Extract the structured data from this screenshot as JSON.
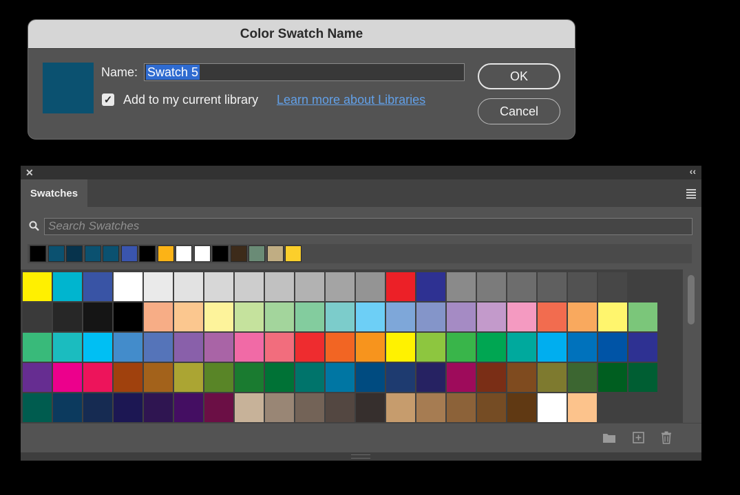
{
  "dialog": {
    "title": "Color Swatch Name",
    "preview_color": "#0b5170",
    "name_label": "Name:",
    "name_value": "Swatch 5",
    "checkbox_checked": true,
    "checkbox_label": "Add to my current library",
    "link_text": "Learn more about Libraries",
    "ok_label": "OK",
    "cancel_label": "Cancel"
  },
  "panel": {
    "tab_label": "Swatches",
    "search_placeholder": "Search Swatches",
    "recent_colors": [
      "#000000",
      "#0b5170",
      "#07334c",
      "#0b5170",
      "#0b5170",
      "#3a55ae",
      "#000000",
      "#fcb316",
      "#ffffff",
      "#ffffff",
      "#000000",
      "#3d2b1a",
      "#6a8b76",
      "#c0ad83",
      "#fccf2b"
    ],
    "swatch_rows": [
      [
        "#fff000",
        "#00b5cf",
        "#3954a5",
        "#ffffff",
        "#eaeaea",
        "#e2e2e2",
        "#d7d7d7",
        "#cdcdcd",
        "#c1c1c1",
        "#b2b2b2",
        "#a4a4a4",
        "#949494",
        "#ec2027",
        "#2e3192",
        "#8a8a8a",
        "#7b7b7b",
        "#6d6d6d",
        "#5f5f5f",
        "#525252",
        "#474747"
      ],
      [
        "#3a3a3a",
        "#272727",
        "#151515",
        "#000000",
        "#f7ad86",
        "#fbc78f",
        "#fdf39b",
        "#c5e29d",
        "#a3d59c",
        "#83cc9e",
        "#7ccccb",
        "#6dcff6",
        "#7ea7d9",
        "#8495c9",
        "#a58bc4",
        "#c39acb",
        "#f49ac1",
        "#f26c4f",
        "#f9a95e",
        "#fff56d",
        "#7bc67a"
      ],
      [
        "#39ba7a",
        "#1bbcbf",
        "#00bff3",
        "#438ccb",
        "#5574b9",
        "#8960aa",
        "#a964a6",
        "#f16aa6",
        "#f26d7d",
        "#ee2c2f",
        "#f26523",
        "#f7941d",
        "#fff200",
        "#8dc63f",
        "#39b54a",
        "#00a652",
        "#00a99d",
        "#00aeef",
        "#0072bc",
        "#0054a6",
        "#2e3192"
      ],
      [
        "#662d91",
        "#ec008c",
        "#ed145b",
        "#a0410d",
        "#a3621b",
        "#aba533",
        "#598527",
        "#1a7b30",
        "#007236",
        "#00746b",
        "#0076a3",
        "#004b80",
        "#1e3b70",
        "#262262",
        "#9e0b5b",
        "#7a2e16",
        "#7f4b1f",
        "#7e7a2f",
        "#3c6631",
        "#005e20",
        "#005e33"
      ],
      [
        "#005c4f",
        "#0c3a5e",
        "#162b52",
        "#1c1753",
        "#2f1551",
        "#440e62",
        "#6b0f45",
        "#c7b299",
        "#998675",
        "#736357",
        "#534741",
        "#362f2d",
        "#c69c6d",
        "#a67c52",
        "#8c6239",
        "#754c24",
        "#603913",
        "#ffffff",
        "#fcc38c"
      ]
    ]
  }
}
